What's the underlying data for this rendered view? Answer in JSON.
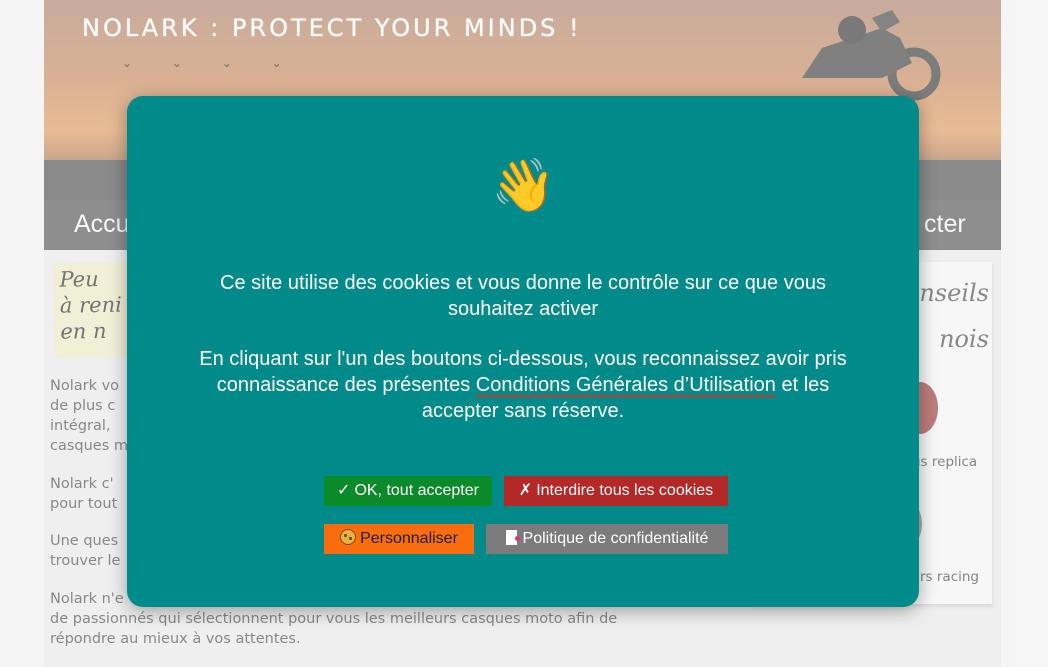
{
  "site": {
    "title": "NOLARK : PROTECT YOUR MINDS !",
    "nav_left": "Accu",
    "nav_right": "cter",
    "note_lines": [
      "Peu",
      "à reni",
      "en n"
    ],
    "paragraphs": [
      [
        "Nolark vo",
        "de plus c",
        "intégral,",
        "casques m"
      ],
      [
        "Nolark c'",
        "pour tout"
      ],
      [
        "Une ques",
        "trouver le"
      ],
      [
        "Nolark n'e",
        "de passionnés qui sélectionnent pour vous les meilleurs casques moto afin de",
        "répondre au mieux à vos attentes."
      ]
    ],
    "side_heading": [
      "nseils",
      "nois"
    ],
    "side_items": [
      "us replica",
      "rs racing"
    ]
  },
  "modal": {
    "emoji": "👋",
    "intro_line1": "Ce site utilise des cookies et vous donne le contrôle sur ce que vous",
    "intro_line2": "souhaitez activer",
    "body_line1": "En cliquant sur l'un des boutons ci-dessous, vous reconnaissez avoir pris",
    "body_line2_before": "connaissance des présentes ",
    "body_link": "Conditions Générales d’Utilisation",
    "body_line2_after": " et les",
    "body_line3": "accepter sans réserve.",
    "buttons": {
      "accept": "OK, tout accepter",
      "accept_icon": "✓",
      "deny": "Interdire tous les cookies",
      "deny_icon": "✗",
      "customize": "Personnaliser",
      "policy": "Politique de confidentialité"
    },
    "colors": {
      "modal_bg": "#018a8a",
      "accept": "#0b8a2a",
      "deny": "#b52828",
      "customize": "#fa6d0f",
      "policy": "#7b7b7b"
    }
  }
}
